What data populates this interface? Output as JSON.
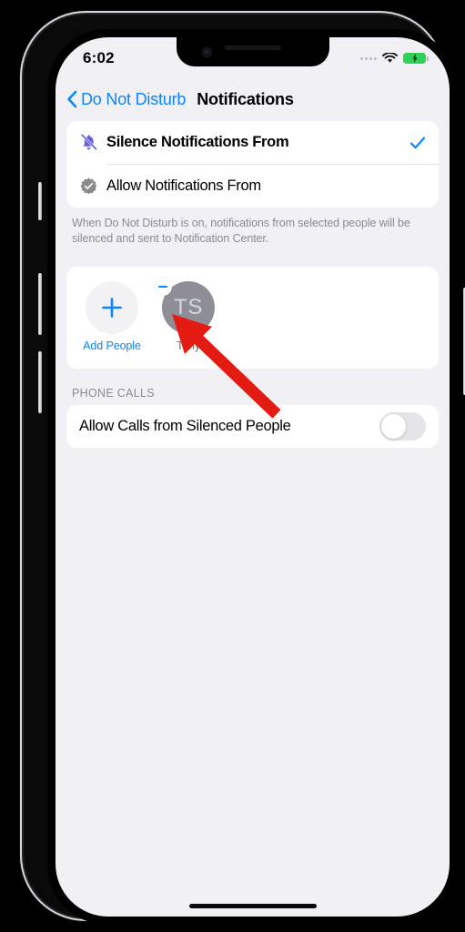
{
  "status_bar": {
    "time": "6:02",
    "signal_icon": "signal-dots-icon",
    "wifi_icon": "wifi-icon",
    "battery_icon": "battery-charging-icon"
  },
  "nav": {
    "back_label": "Do Not Disturb",
    "back_icon": "chevron-left-icon",
    "title": "Notifications"
  },
  "options": [
    {
      "label": "Silence Notifications From",
      "icon": "bell-slash-icon",
      "icon_color": "#5e5ce6",
      "selected": true,
      "check_icon": "checkmark-icon"
    },
    {
      "label": "Allow Notifications From",
      "icon": "checkmark-seal-icon",
      "icon_color": "#8a8a90",
      "selected": false
    }
  ],
  "footnote": "When Do Not Disturb is on, notifications from selected people will be silenced and sent to Notification Center.",
  "people": {
    "add_people": {
      "label": "Add People",
      "icon": "plus-icon"
    },
    "entries": [
      {
        "name": "Tony",
        "initials": "TS",
        "remove_badge_icon": "minus-badge-icon",
        "avatar_color": "#8e8e96"
      }
    ]
  },
  "phone_calls": {
    "header": "PHONE CALLS",
    "row_label": "Allow Calls from Silenced People",
    "toggle_state": "off"
  },
  "annotation": {
    "arrow_icon": "red-arrow-icon",
    "arrow_color": "#e31b13",
    "points_to": "minus-badge-icon"
  },
  "colors": {
    "accent_blue": "#0a84ff",
    "background": "#f1f1f5",
    "card": "#ffffff",
    "purple": "#5e5ce6",
    "battery_green": "#30d158"
  }
}
